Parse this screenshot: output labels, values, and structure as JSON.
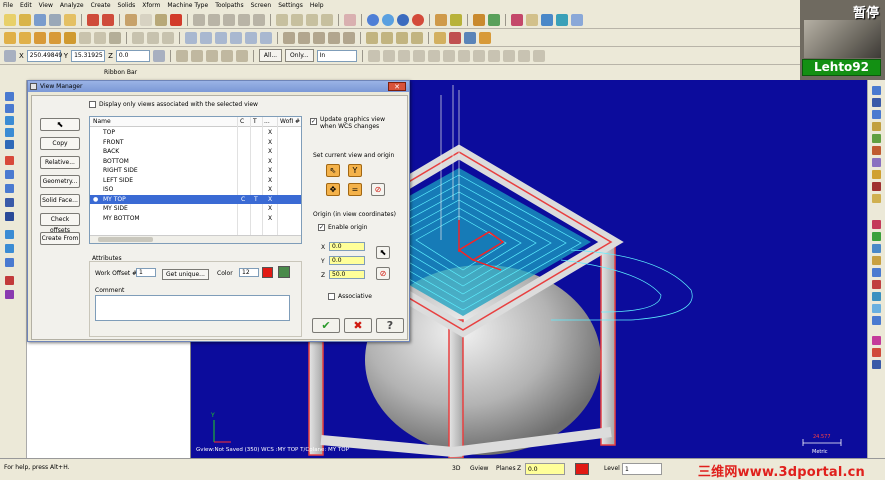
{
  "menu": [
    "File",
    "Edit",
    "View",
    "Analyze",
    "Create",
    "Solids",
    "Xform",
    "Machine Type",
    "Toolpaths",
    "Screen",
    "Settings",
    "Help"
  ],
  "toolbar": {
    "x_label": "X",
    "x_value": "250.49849",
    "y_label": "Y",
    "y_value": "15.31925",
    "z_label": "Z",
    "z_value": "0.0",
    "all_button": "All...",
    "only_button": "Only...",
    "in_select": "In"
  },
  "ribbon_label": "Ribbon Bar",
  "webcam": {
    "pause_text": "暂停",
    "name": "Lehto92"
  },
  "dialog": {
    "title": "View Manager",
    "display_only_label": "Display only views associated with the selected view",
    "side_buttons": [
      "Copy",
      "Relative...",
      "Geometry...",
      "Solid Face...",
      "Check offsets",
      "Create From"
    ],
    "list_headers": {
      "name": "Name",
      "c": "C",
      "t": "T",
      "chain": "...",
      "wofs": "WofI #"
    },
    "views": [
      {
        "name": "TOP",
        "x": "X",
        "selected": false
      },
      {
        "name": "FRONT",
        "x": "X",
        "selected": false
      },
      {
        "name": "BACK",
        "x": "X",
        "selected": false
      },
      {
        "name": "BOTTOM",
        "x": "X",
        "selected": false
      },
      {
        "name": "RIGHT SIDE",
        "x": "X",
        "selected": false
      },
      {
        "name": "LEFT SIDE",
        "x": "X",
        "selected": false
      },
      {
        "name": "ISO",
        "x": "X",
        "selected": false
      },
      {
        "name": "MY TOP",
        "x": "X",
        "selected": true
      },
      {
        "name": "MY SIDE",
        "x": "X",
        "selected": false
      },
      {
        "name": "MY BOTTOM",
        "x": "X",
        "selected": false
      }
    ],
    "selected_row_flags": [
      "C",
      "T",
      "X"
    ],
    "attributes_label": "Attributes",
    "work_offset_label": "Work Offset #",
    "work_offset_value": "1",
    "get_unique_button": "Get unique...",
    "color_label": "Color",
    "color_value": "12",
    "color_swatch": "#e11a14",
    "comment_label": "Comment",
    "update_graphics_label": "Update graphics view when WCS changes",
    "set_current_label": "Set current view and origin",
    "origin_label": "Origin (in view coordinates)",
    "enable_origin_label": "Enable origin",
    "x_label": "X",
    "x_value": "0.0",
    "y_label": "Y",
    "y_value": "0.0",
    "z_label": "Z",
    "z_value": "50.0",
    "associative_label": "Associative",
    "ok_symbol": "✔",
    "cancel_symbol": "✖",
    "help_symbol": "?"
  },
  "viewport": {
    "bottom_text": "Gview:Not Saved (350)   WCS :MY TOP   T/Cplane: MY TOP",
    "axis_label": "Y",
    "scale_value": "24.577",
    "scale_unit": "Metric"
  },
  "status": {
    "help": "For help, press Alt+H.",
    "mode_3d": "3D",
    "gview": "Gview",
    "planes": "Planes",
    "z_label": "Z",
    "z_value": "0.0",
    "level_label": "Level",
    "level_value": "1",
    "watermark": "三维网www.3dportal.cn"
  }
}
